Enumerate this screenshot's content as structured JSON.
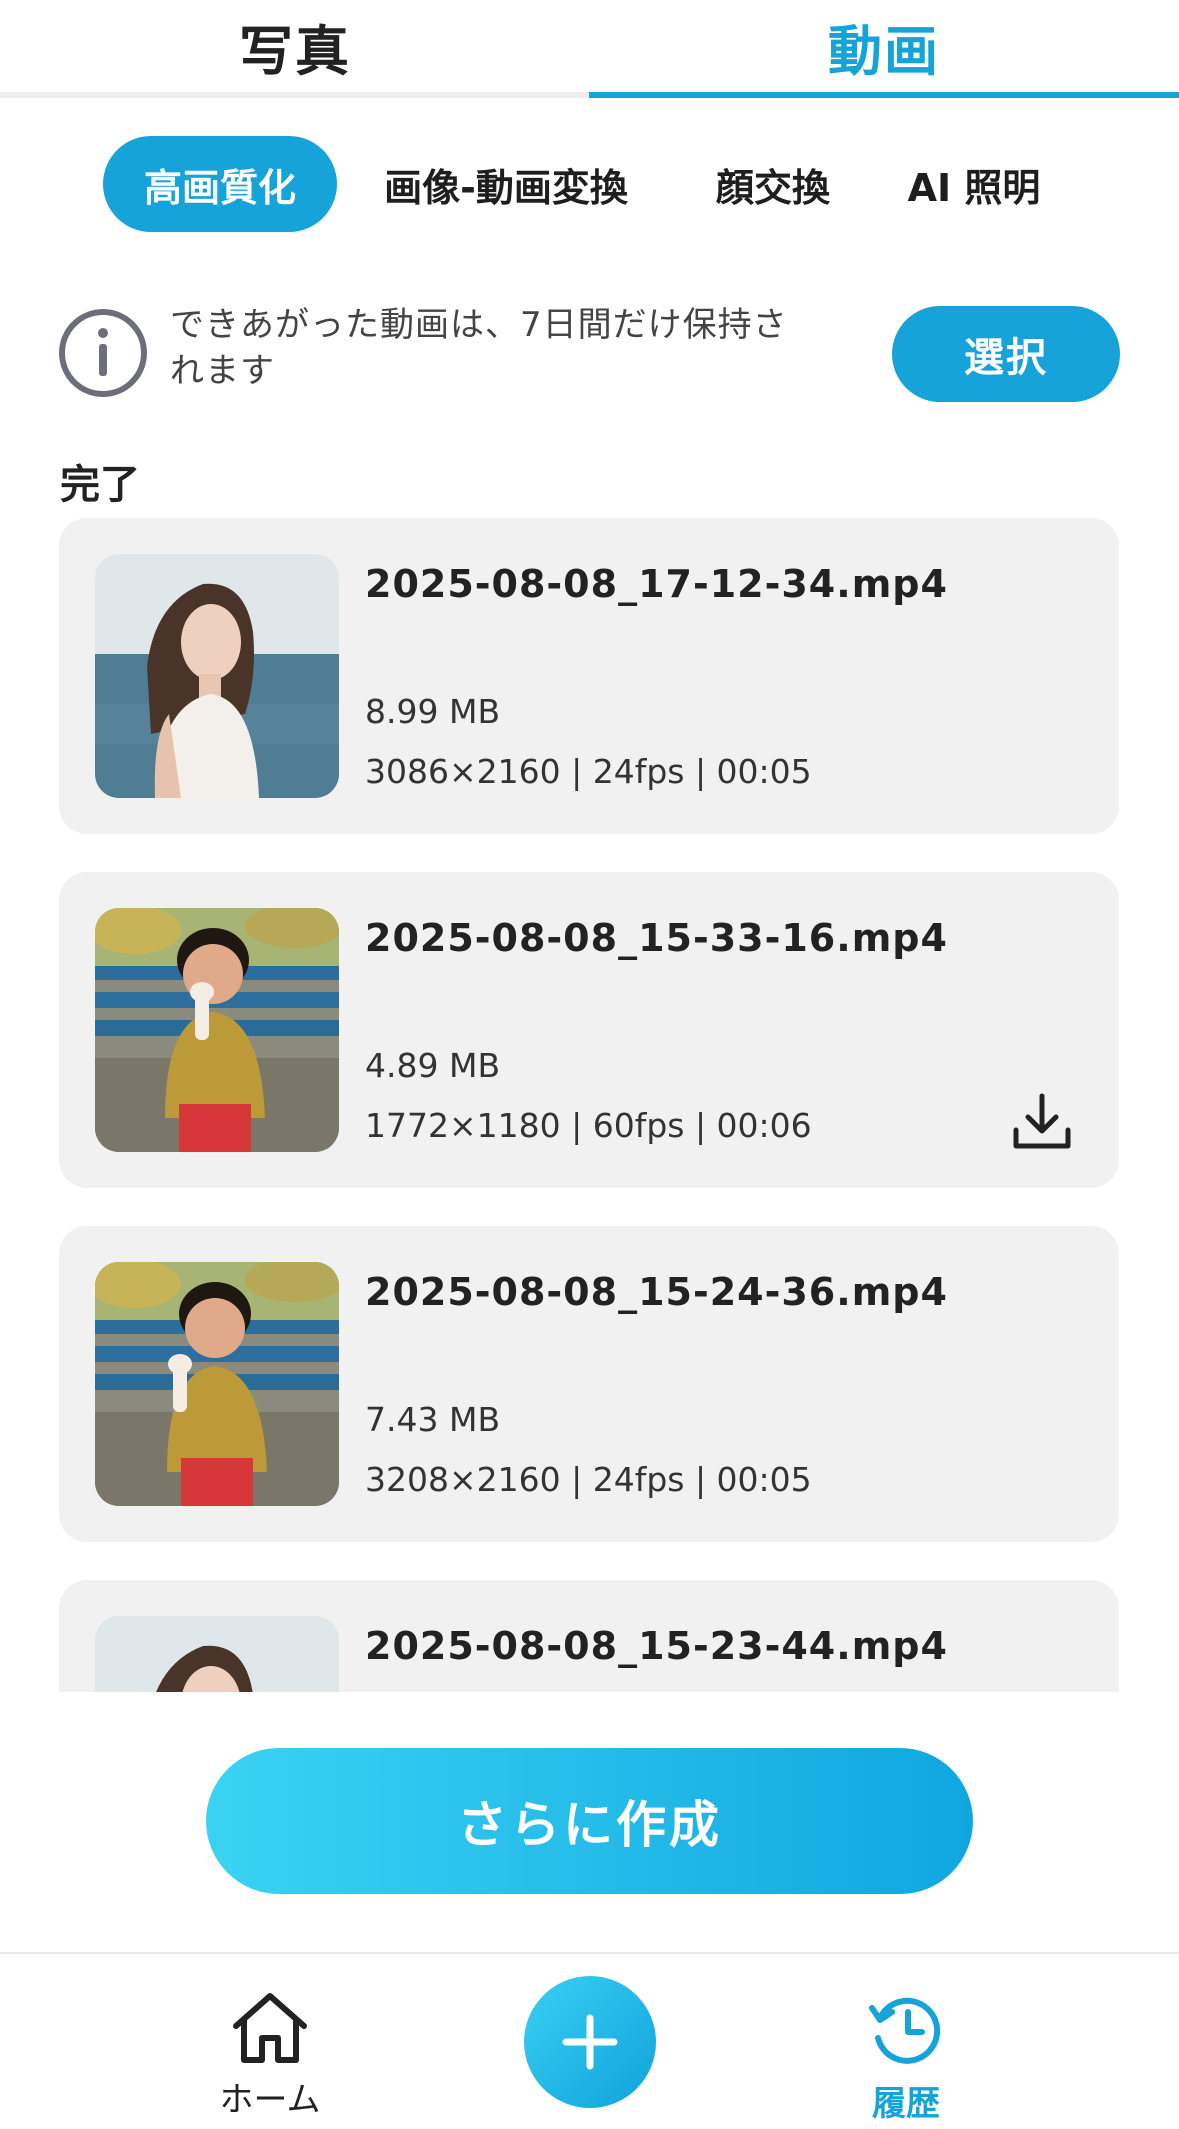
{
  "top_tabs": {
    "photo": "写真",
    "video": "動画",
    "active": "video"
  },
  "sub_tabs": [
    {
      "label": "高画質化",
      "active": true
    },
    {
      "label": "画像-動画変換",
      "active": false
    },
    {
      "label": "顔交換",
      "active": false
    },
    {
      "label": "AI 照明",
      "active": false
    }
  ],
  "notice": {
    "icon": "info-icon",
    "text": "できあがった動画は、7日間だけ保持されます",
    "select_label": "選択"
  },
  "section_title": "完了",
  "videos": [
    {
      "filename": "2025-08-08_17-12-34.mp4",
      "size": "8.99 MB",
      "meta": "3086×2160 | 24fps | 00:05",
      "thumbnail": "woman-by-sea",
      "download_icon": false
    },
    {
      "filename": "2025-08-08_15-33-16.mp4",
      "size": "4.89 MB",
      "meta": "1772×1180 | 60fps | 00:06",
      "thumbnail": "child-with-ice-cream",
      "download_icon": true
    },
    {
      "filename": "2025-08-08_15-24-36.mp4",
      "size": "7.43 MB",
      "meta": "3208×2160 | 24fps | 00:05",
      "thumbnail": "child-with-ice-cream",
      "download_icon": false
    },
    {
      "filename": "2025-08-08_15-23-44.mp4",
      "size": "",
      "meta": "",
      "thumbnail": "woman-by-sea",
      "download_icon": false
    }
  ],
  "create_more_label": "さらに作成",
  "bottom_nav": {
    "home_label": "ホーム",
    "history_label": "履歴",
    "active": "history"
  },
  "colors": {
    "accent": "#16a3d9",
    "card_bg": "#f1f1f1"
  }
}
